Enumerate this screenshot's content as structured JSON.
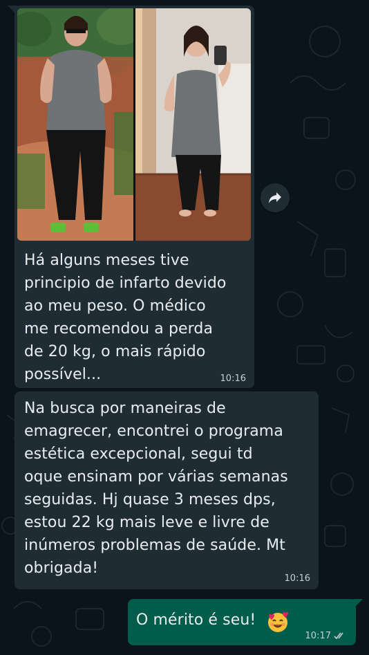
{
  "chat": {
    "messages": [
      {
        "type": "image_with_caption",
        "direction": "incoming",
        "text": "Há alguns meses tive\nprincipio de infarto devido\nao meu peso. O médico\nme recomendou a perda\nde 20 kg, o mais rápido\npossível...",
        "time": "10:16",
        "forward_icon": "forward-arrow-icon"
      },
      {
        "type": "text",
        "direction": "incoming",
        "text": "Na busca por maneiras de\nemagrecer, encontrei o programa\nestética excepcional, segui td\noque ensinam por várias semanas\nseguidas. Hj quase 3 meses dps,\nestou 22 kg mais leve e livre de\ninúmeros problemas de saúde. Mt\nobrigada!",
        "time": "10:16"
      },
      {
        "type": "text",
        "direction": "outgoing",
        "text": "O mérito é seu!",
        "emoji": "smiling-face-with-hearts-icon",
        "time": "10:17",
        "status_icon": "double-check-icon"
      }
    ]
  },
  "colors": {
    "background": "#0b141a",
    "incoming_bubble": "#1f2c34",
    "outgoing_bubble": "#005c4b",
    "text": "#e9edef",
    "meta": "#c7d0d4"
  }
}
